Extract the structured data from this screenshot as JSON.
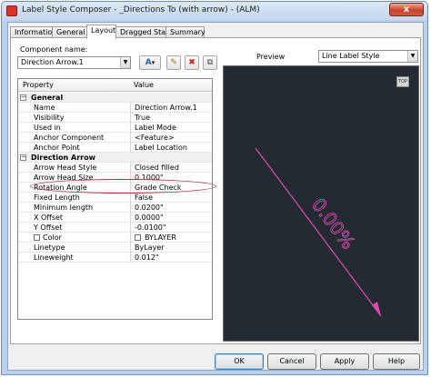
{
  "window": {
    "title": "Label Style Composer - _Directions To (with arrow) - (ALM)",
    "close_glyph": "x"
  },
  "tabs": [
    "Information",
    "General",
    "Layout",
    "Dragged State",
    "Summary"
  ],
  "active_tab": "Layout",
  "component": {
    "label": "Component name:",
    "selected": "Direction Arrow.1"
  },
  "toolbar": {
    "add_glyph": "A",
    "add_dropdown_glyph": "▾",
    "new_glyph": "✎",
    "delete_glyph": "✖",
    "copy_glyph": "⧉"
  },
  "grid": {
    "header_property": "Property",
    "header_value": "Value",
    "groups": [
      {
        "name": "General",
        "expander": "−",
        "rows": [
          {
            "property": "Name",
            "value": "Direction Arrow.1"
          },
          {
            "property": "Visibility",
            "value": "True"
          },
          {
            "property": "Used in",
            "value": "Label Mode"
          },
          {
            "property": "Anchor Component",
            "value": "<Feature>"
          },
          {
            "property": "Anchor Point",
            "value": "Label Location"
          }
        ]
      },
      {
        "name": "Direction Arrow",
        "expander": "−",
        "rows": [
          {
            "property": "Arrow Head Style",
            "value": "Closed filled"
          },
          {
            "property": "Arrow Head Size",
            "value": "0.1000\""
          },
          {
            "property": "Rotation Angle",
            "value": "Grade Check"
          },
          {
            "property": "Fixed Length",
            "value": "False"
          },
          {
            "property": "Minimum length",
            "value": "0.0200\""
          },
          {
            "property": "X Offset",
            "value": "0.0000\""
          },
          {
            "property": "Y Offset",
            "value": "-0.0100\""
          },
          {
            "property": "Color",
            "value": "BYLAYER"
          },
          {
            "property": "Linetype",
            "value": "ByLayer"
          },
          {
            "property": "Lineweight",
            "value": "0.012\""
          }
        ]
      }
    ]
  },
  "preview": {
    "label": "Preview",
    "style_selected": "Line Label Style",
    "top_button": "TOP",
    "sample_text": "0.00%",
    "line_color": "#e04bb3",
    "background_color": "#242a31"
  },
  "buttons": {
    "ok": "OK",
    "cancel": "Cancel",
    "apply": "Apply",
    "help": "Help"
  },
  "colors": {
    "highlight_ellipse": "#a6323b",
    "title_bar": "#c3d7ee"
  }
}
